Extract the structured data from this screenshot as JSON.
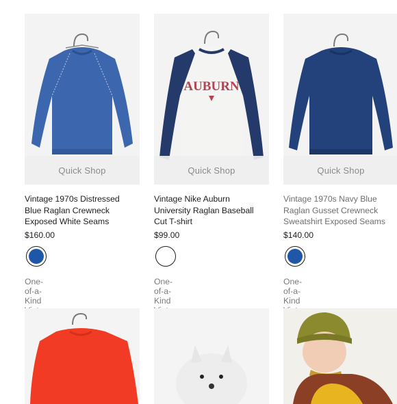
{
  "products": [
    {
      "quick_shop": "Quick Shop",
      "title_lines": [
        "Vintage 1970s Distressed",
        "Blue Raglan Crewneck",
        "Exposed White Seams"
      ],
      "price": "$160.00",
      "swatch_color": "#1f57a8",
      "vendor": "One-of-a-Kind Vintage",
      "image": "blue-raglan-crewneck-sweatshirt"
    },
    {
      "quick_shop": "Quick Shop",
      "title_lines": [
        "Vintage Nike Auburn",
        "University Raglan Baseball",
        "Cut T-shirt"
      ],
      "graphic_text": "AUBURN",
      "price": "$99.00",
      "swatch_color": "#ffffff",
      "vendor": "One-of-a-Kind Vintage",
      "image": "auburn-raglan-baseball-tee"
    },
    {
      "quick_shop": "Quick Shop",
      "title_lines": [
        "Vintage 1970s Navy Blue",
        "Raglan Gusset Crewneck",
        "Sweatshirt Exposed Seams"
      ],
      "price": "$140.00",
      "swatch_color": "#1f57a8",
      "vendor": "One-of-a-Kind Vintage",
      "image": "navy-raglan-crewneck-sweatshirt"
    }
  ],
  "row2_images": [
    "red-sweatshirt",
    "white-dog",
    "model-green-beanie"
  ]
}
